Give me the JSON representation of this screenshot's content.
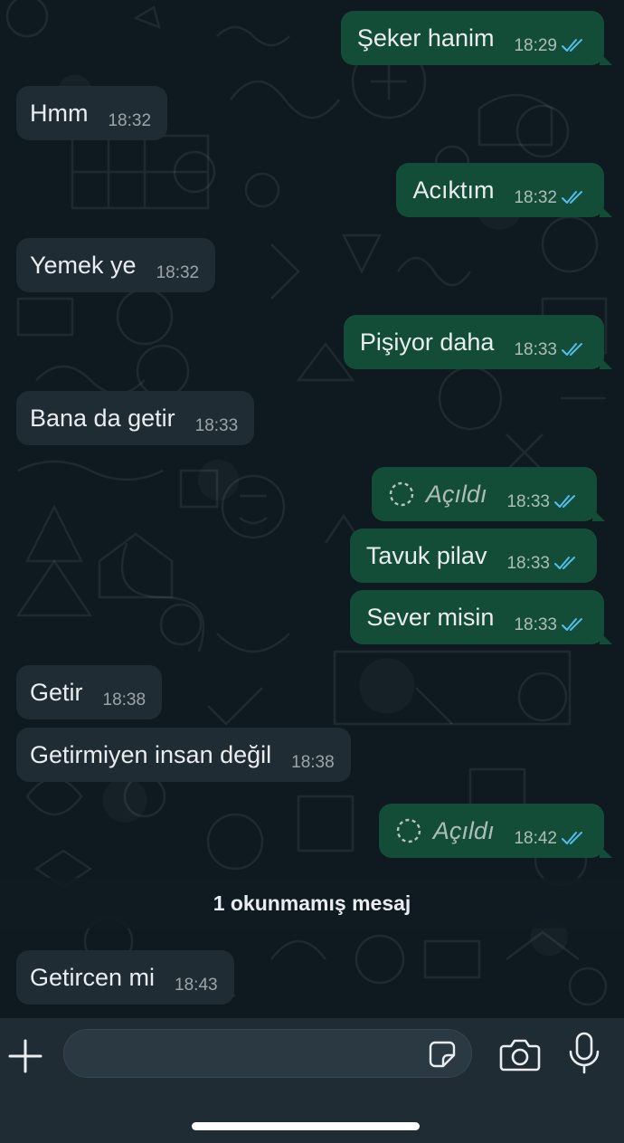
{
  "colors": {
    "incoming_bubble": "#1f2c33",
    "outgoing_bubble": "#144d37",
    "read_ticks": "#53bdeb",
    "chat_background": "#0f1a20"
  },
  "messages": [
    {
      "direction": "out",
      "text": "Şeker hanim",
      "time": "18:29",
      "status": "read"
    },
    {
      "direction": "in",
      "text": "Hmm",
      "time": "18:32"
    },
    {
      "direction": "out",
      "text": "Acıktım",
      "time": "18:32",
      "status": "read"
    },
    {
      "direction": "in",
      "text": "Yemek ye",
      "time": "18:32"
    },
    {
      "direction": "out",
      "text": "Pişiyor daha",
      "time": "18:33",
      "status": "read"
    },
    {
      "direction": "in",
      "text": "Bana da getir",
      "time": "18:33"
    },
    {
      "direction": "out",
      "text": "Açıldı",
      "time": "18:33",
      "status": "read",
      "view_once": true
    },
    {
      "direction": "out",
      "text": "Tavuk pilav",
      "time": "18:33",
      "status": "read"
    },
    {
      "direction": "out",
      "text": "Sever misin",
      "time": "18:33",
      "status": "read"
    },
    {
      "direction": "in",
      "text": "Getir",
      "time": "18:38"
    },
    {
      "direction": "in",
      "text": "Getirmiyen insan değil",
      "time": "18:38"
    },
    {
      "direction": "out",
      "text": "Açıldı",
      "time": "18:42",
      "status": "read",
      "view_once": true
    },
    {
      "direction": "in",
      "text": "Getircen mi",
      "time": "18:43"
    }
  ],
  "unread_banner": "1 okunmamış mesaj",
  "input_bar": {
    "message_value": "",
    "plus_icon": "plus-icon",
    "sticker_icon": "sticker-icon",
    "camera_icon": "camera-icon",
    "mic_icon": "microphone-icon"
  }
}
